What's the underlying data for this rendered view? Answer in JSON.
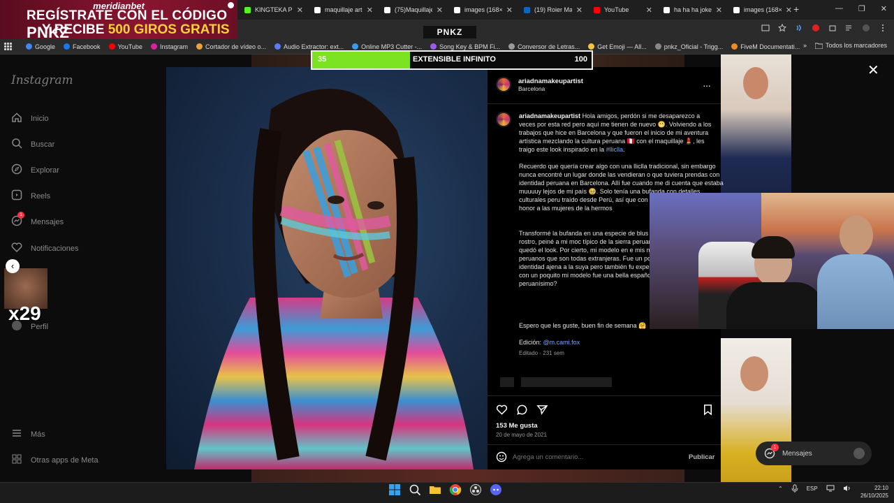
{
  "promo": {
    "brand": "meridianbet",
    "line1": "REGÍSTRATE CON EL CÓDIGO",
    "code": "PNKZ",
    "line2_prefix": "Y RECIBE",
    "line2_highlight": "500 GIROS GRATIS"
  },
  "tabs": [
    {
      "label": "KINGTEKA PER",
      "icon": "kick-icon"
    },
    {
      "label": "maquillaje artí",
      "icon": "google-icon"
    },
    {
      "label": "(75)Maquillaje",
      "icon": "tiktok-icon"
    },
    {
      "label": "images (168×3",
      "icon": "google-icon"
    },
    {
      "label": "(19) Roier Mall",
      "icon": "linkedin-icon"
    },
    {
      "label": "YouTube",
      "icon": "youtube-icon"
    },
    {
      "label": "ha ha ha joker",
      "icon": "google-icon"
    },
    {
      "label": "images (168×3",
      "icon": "google-icon"
    }
  ],
  "header_logo": "PNKZ",
  "bookmarks": [
    {
      "label": "Google",
      "color": "#4285f4"
    },
    {
      "label": "Facebook",
      "color": "#1877f2"
    },
    {
      "label": "YouTube",
      "color": "#ff0000"
    },
    {
      "label": "Instagram",
      "color": "#d6249f"
    },
    {
      "label": "Cortador de vídeo o...",
      "color": "#e8a33a"
    },
    {
      "label": "Audio Extractor: ext...",
      "color": "#5b7cfa"
    },
    {
      "label": "Online MP3 Cutter -...",
      "color": "#3a9be8"
    },
    {
      "label": "Song Key & BPM Fi...",
      "color": "#9a5be8"
    },
    {
      "label": "Conversor de Letras...",
      "color": "#999999"
    },
    {
      "label": "Get Emoji — All...",
      "color": "#f5c542"
    },
    {
      "label": "pnkz_Oficial - Trigg...",
      "color": "#888888"
    },
    {
      "label": "FiveM Documentati...",
      "color": "#f08a24"
    }
  ],
  "bookmarks_folder": "Todos los marcadores",
  "hud": {
    "left_value": "35",
    "label": "EXTENSIBLE INFINITO",
    "right_value": "100",
    "progress": 0.35
  },
  "sidebar": {
    "logo": "Instagram",
    "items": [
      {
        "label": "Inicio",
        "icon": "home-icon"
      },
      {
        "label": "Buscar",
        "icon": "search-icon"
      },
      {
        "label": "Explorar",
        "icon": "compass-icon"
      },
      {
        "label": "Reels",
        "icon": "reels-icon"
      },
      {
        "label": "Mensajes",
        "icon": "messenger-icon",
        "badge": "1"
      },
      {
        "label": "Notificaciones",
        "icon": "heart-icon"
      },
      {
        "label": "Perfil",
        "icon": "avatar-icon"
      },
      {
        "label": "Más",
        "icon": "menu-icon"
      },
      {
        "label": "Otras apps de Meta",
        "icon": "meta-icon"
      }
    ]
  },
  "sticker": {
    "text": "x29"
  },
  "post": {
    "username": "ariadnamakeupartist",
    "location": "Barcelona",
    "caption_p1_rest": "Hola amigos, perdón si me desaparezco a veces por esta red pero aquí me tienen de nuevo 😬. Volviendo a los trabajos que hice en Barcelona y que fueron el inicio de mi aventura artística mezclando la cultura peruana 🇵🇪 con el maquillaje 💄, les traigo este look inspirado en la",
    "hashtag": "#lliclla",
    "caption_p2": "Recuerdo que quería crear algo con una lliclla tradicional, sin embargo nunca encontré un lugar donde las vendieran o que tuviera prendas con identidad peruana en Barcelona. Allí fue cuando me di cuenta que estaba muuuuy lejos de mi país 🥹. Solo tenía una bufanda con detalles culturales peru traído desde Perú, así que con ingenio, basán este look en honor a las mujeres de la hermos",
    "caption_p3": "Transformé la bufanda en una especie de blus figuras de la tela en mi rostro, peiné a mi moc típico de la sierra peruana), coloqué más detal y así quedó el look. Por cierto, mi modelo en e mis modelos en los otros looks peruanos que son todas extranjeras. Fue un poco extraño pa una identidad ajena a la suya pero también fu experiencia de 'caracterizarlas' con un poquito mi modelo fue una bella española, ¿a qué se l look peruanísimo?",
    "caption_p4": "Espero que les guste, buen fin de semana 🤗",
    "credit_prefix": "Edición:",
    "credit_handle": "@m.cami.fox",
    "edited": "Editado · 231 sem",
    "likes": "153 Me gusta",
    "date": "20 de mayo de 2021",
    "comment_placeholder": "Agrega un comentario...",
    "publish": "Publicar"
  },
  "messages_pill": {
    "label": "Mensajes",
    "badge": "1"
  },
  "taskbar": {
    "apps": [
      "windows-start-icon",
      "search-icon",
      "file-explorer-icon",
      "chrome-icon",
      "obs-icon",
      "discord-icon"
    ],
    "lang": "ESP",
    "time": "22:10",
    "date": "26/10/2025"
  }
}
